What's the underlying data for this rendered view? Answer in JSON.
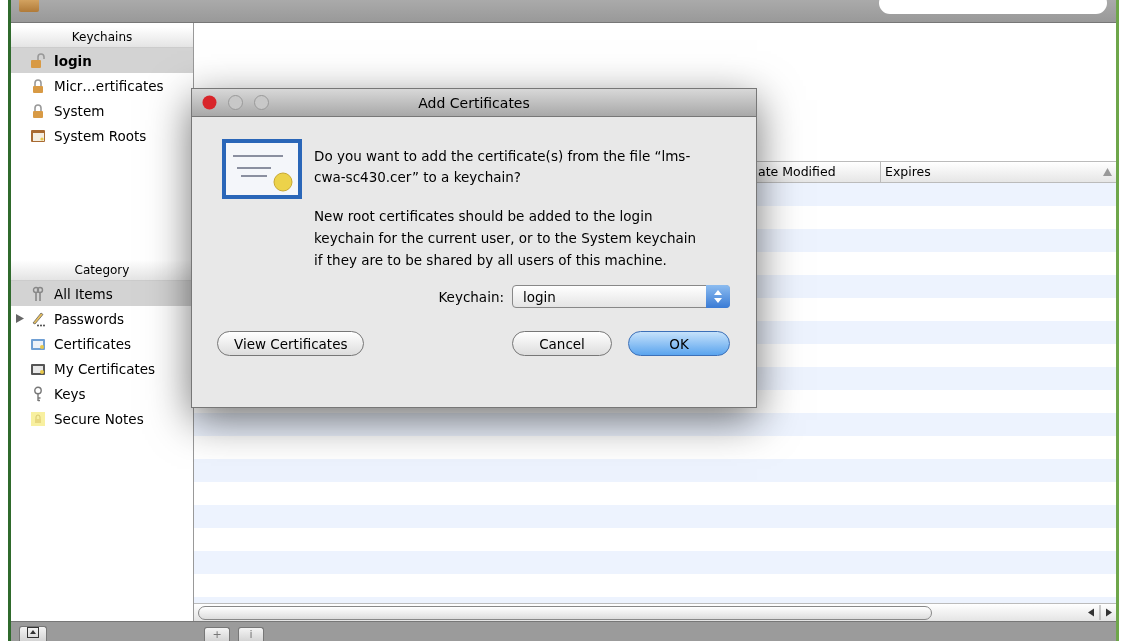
{
  "sidebar": {
    "keychains": {
      "header": "Keychains",
      "items": [
        {
          "label": "login",
          "kind": "unlocked",
          "selected": true
        },
        {
          "label": "Micr…ertificates",
          "kind": "locked",
          "selected": false
        },
        {
          "label": "System",
          "kind": "locked",
          "selected": false
        },
        {
          "label": "System Roots",
          "kind": "roots",
          "selected": false
        }
      ]
    },
    "category": {
      "header": "Category",
      "items": [
        {
          "label": "All Items",
          "kind": "all",
          "selected": true
        },
        {
          "label": "Passwords",
          "kind": "passwords",
          "selected": false,
          "expanded": false
        },
        {
          "label": "Certificates",
          "kind": "certificates",
          "selected": false
        },
        {
          "label": "My Certificates",
          "kind": "mycertificates",
          "selected": false
        },
        {
          "label": "Keys",
          "kind": "keys",
          "selected": false
        },
        {
          "label": "Secure Notes",
          "kind": "notes",
          "selected": false
        }
      ]
    }
  },
  "table": {
    "columns": [
      {
        "label": "ate Modified"
      },
      {
        "label": "Expires",
        "sorted": true
      }
    ]
  },
  "bottom_bar": {
    "buttons": [
      "+",
      "i"
    ]
  },
  "dialog": {
    "title": "Add Certificates",
    "message": "Do you want to add the certificate(s) from the file “lms-cwa-sc430.cer” to a keychain?",
    "info": "New root certificates should be added to the login keychain for the current user, or to the System keychain if they are to be shared by all users of this machine.",
    "keychain_label": "Keychain:",
    "keychain_value": "login",
    "buttons": [
      {
        "label": "View Certificates",
        "default": false
      },
      {
        "label": "Cancel",
        "default": false
      },
      {
        "label": "OK",
        "default": true
      }
    ]
  }
}
